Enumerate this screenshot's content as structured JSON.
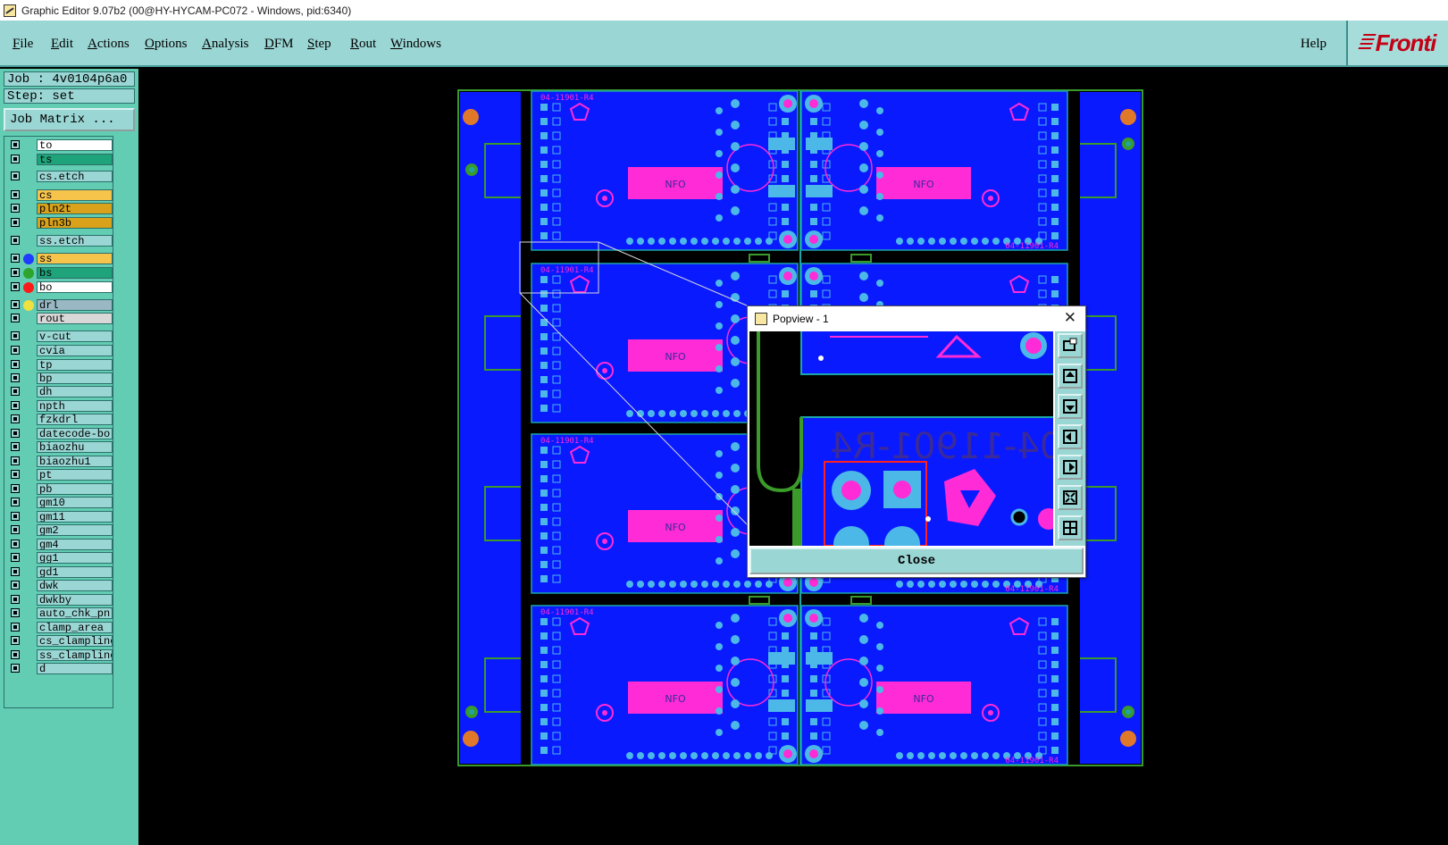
{
  "window": {
    "title": "Graphic Editor 9.07b2 (00@HY-HYCAM-PC072 - Windows, pid:6340)"
  },
  "menu": {
    "items": [
      {
        "label": "File",
        "u": "F",
        "rest": "ile"
      },
      {
        "label": "Edit",
        "u": "E",
        "rest": "dit"
      },
      {
        "label": "Actions",
        "u": "A",
        "rest": "ctions"
      },
      {
        "label": "Options",
        "u": "O",
        "rest": "ptions"
      },
      {
        "label": "Analysis",
        "u": "A",
        "rest": "nalysis"
      },
      {
        "label": "DFM",
        "u": "D",
        "rest": "FM"
      },
      {
        "label": "Step",
        "u": "S",
        "rest": "tep"
      },
      {
        "label": "Rout",
        "u": "R",
        "rest": "out"
      },
      {
        "label": "Windows",
        "u": "W",
        "rest": "indows"
      }
    ],
    "help": "Help",
    "brand": "Fronti"
  },
  "job": {
    "job_line": "Job : 4v0104p6a0",
    "step_line": "Step: set",
    "matrix_button": "Job Matrix ..."
  },
  "layers": [
    {
      "name": "to",
      "color": "#ffffff",
      "dot": null
    },
    {
      "name": "ts",
      "color": "#1fa37a",
      "dot": null
    },
    {
      "name": "cs.etch",
      "color": "#9ad6d4",
      "dot": null
    },
    {
      "name": "cs",
      "color": "#f6c34b",
      "dot": null
    },
    {
      "name": "pln2t",
      "color": "#d9a21a",
      "dot": null
    },
    {
      "name": "pln3b",
      "color": "#d9a21a",
      "dot": null
    },
    {
      "name": "ss.etch",
      "color": "#9ad6d4",
      "dot": null
    },
    {
      "name": "ss",
      "color": "#f6c34b",
      "dot": "#1f3cff"
    },
    {
      "name": "bs",
      "color": "#1fa37a",
      "dot": "#2da52d"
    },
    {
      "name": "bo",
      "color": "#ffffff",
      "dot": "#ff1a1a"
    },
    {
      "name": "drl",
      "color": "#9ab8c4",
      "dot": "#f0e040"
    },
    {
      "name": "rout",
      "color": "#d8d8d8",
      "dot": null
    },
    {
      "name": "v-cut",
      "color": "#9ad6d4",
      "dot": null
    },
    {
      "name": "cvia",
      "color": "#9ad6d4",
      "dot": null
    },
    {
      "name": "tp",
      "color": "#9ad6d4",
      "dot": null
    },
    {
      "name": "bp",
      "color": "#9ad6d4",
      "dot": null
    },
    {
      "name": "dh",
      "color": "#9ad6d4",
      "dot": null
    },
    {
      "name": "npth",
      "color": "#9ad6d4",
      "dot": null
    },
    {
      "name": "fzkdrl",
      "color": "#9ad6d4",
      "dot": null
    },
    {
      "name": "datecode-bo",
      "color": "#9ad6d4",
      "dot": null
    },
    {
      "name": "biaozhu",
      "color": "#9ad6d4",
      "dot": null
    },
    {
      "name": "biaozhu1",
      "color": "#9ad6d4",
      "dot": null
    },
    {
      "name": "pt",
      "color": "#9ad6d4",
      "dot": null
    },
    {
      "name": "pb",
      "color": "#9ad6d4",
      "dot": null
    },
    {
      "name": "gm10",
      "color": "#9ad6d4",
      "dot": null
    },
    {
      "name": "gm11",
      "color": "#9ad6d4",
      "dot": null
    },
    {
      "name": "gm2",
      "color": "#9ad6d4",
      "dot": null
    },
    {
      "name": "gm4",
      "color": "#9ad6d4",
      "dot": null
    },
    {
      "name": "gg1",
      "color": "#9ad6d4",
      "dot": null
    },
    {
      "name": "gd1",
      "color": "#9ad6d4",
      "dot": null
    },
    {
      "name": "dwk",
      "color": "#9ad6d4",
      "dot": null
    },
    {
      "name": "dwkby",
      "color": "#9ad6d4",
      "dot": null
    },
    {
      "name": "auto_chk_pnl",
      "color": "#9ad6d4",
      "dot": null
    },
    {
      "name": "clamp_area",
      "color": "#9ad6d4",
      "dot": null
    },
    {
      "name": "cs_clampline",
      "color": "#9ad6d4",
      "dot": null
    },
    {
      "name": "ss_clampline",
      "color": "#9ad6d4",
      "dot": null
    },
    {
      "name": "d",
      "color": "#9ad6d4",
      "dot": null
    }
  ],
  "popview": {
    "title": "Popview - 1",
    "close_glyph": "✕",
    "close_button": "Close",
    "board_text": "04-11901-R4"
  },
  "board": {
    "panel_label": "04-11901-R4",
    "info_label": "NFO"
  },
  "colors": {
    "board_blue": "#0a1aff",
    "pad_cyan": "#4bb8e8",
    "silk_magenta": "#ff2bd6",
    "outline_green": "#3a9a2a",
    "mark_orange": "#e0782a"
  }
}
